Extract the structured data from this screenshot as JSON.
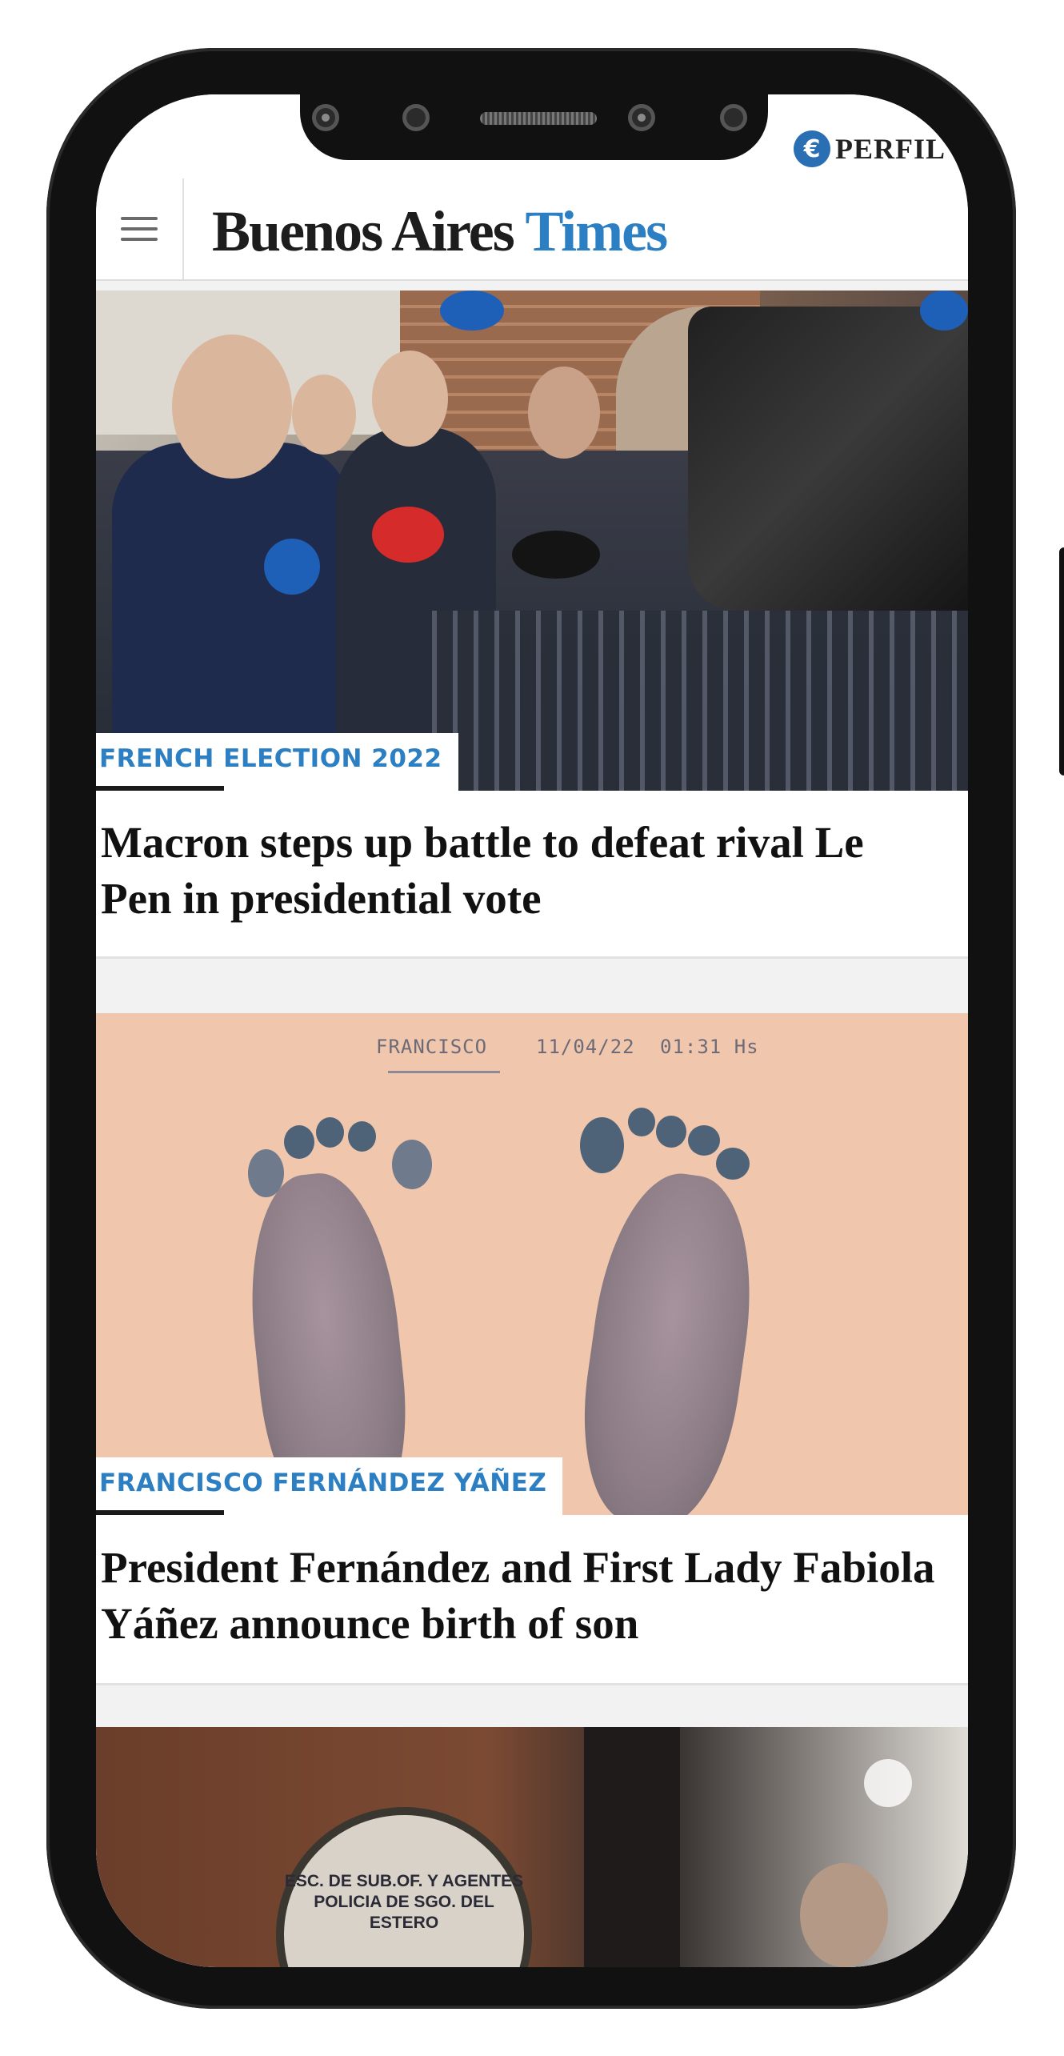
{
  "header": {
    "publisher": "PERFIL",
    "brand_part1": "Buenos Aires",
    "brand_part2": "Times"
  },
  "articles": [
    {
      "kicker": "FRENCH ELECTION 2022",
      "headline": "Macron steps up battle to defeat rival Le Pen in presidential vote"
    },
    {
      "kicker": "FRANCISCO FERNÁNDEZ YÁÑEZ",
      "headline": "President Fernández and First Lady Fabiola Yáñez announce birth of son",
      "photo_annotation": {
        "name": "FRANCISCO",
        "date": "11/04/22",
        "time": "01:31 Hs"
      }
    },
    {
      "patch_text": "ESC. DE SUB.OF. Y AGENTES POLICIA DE SGO. DEL ESTERO"
    }
  ],
  "colors": {
    "accent": "#2b7fc2",
    "text": "#111111",
    "phone_frame": "#111111"
  }
}
